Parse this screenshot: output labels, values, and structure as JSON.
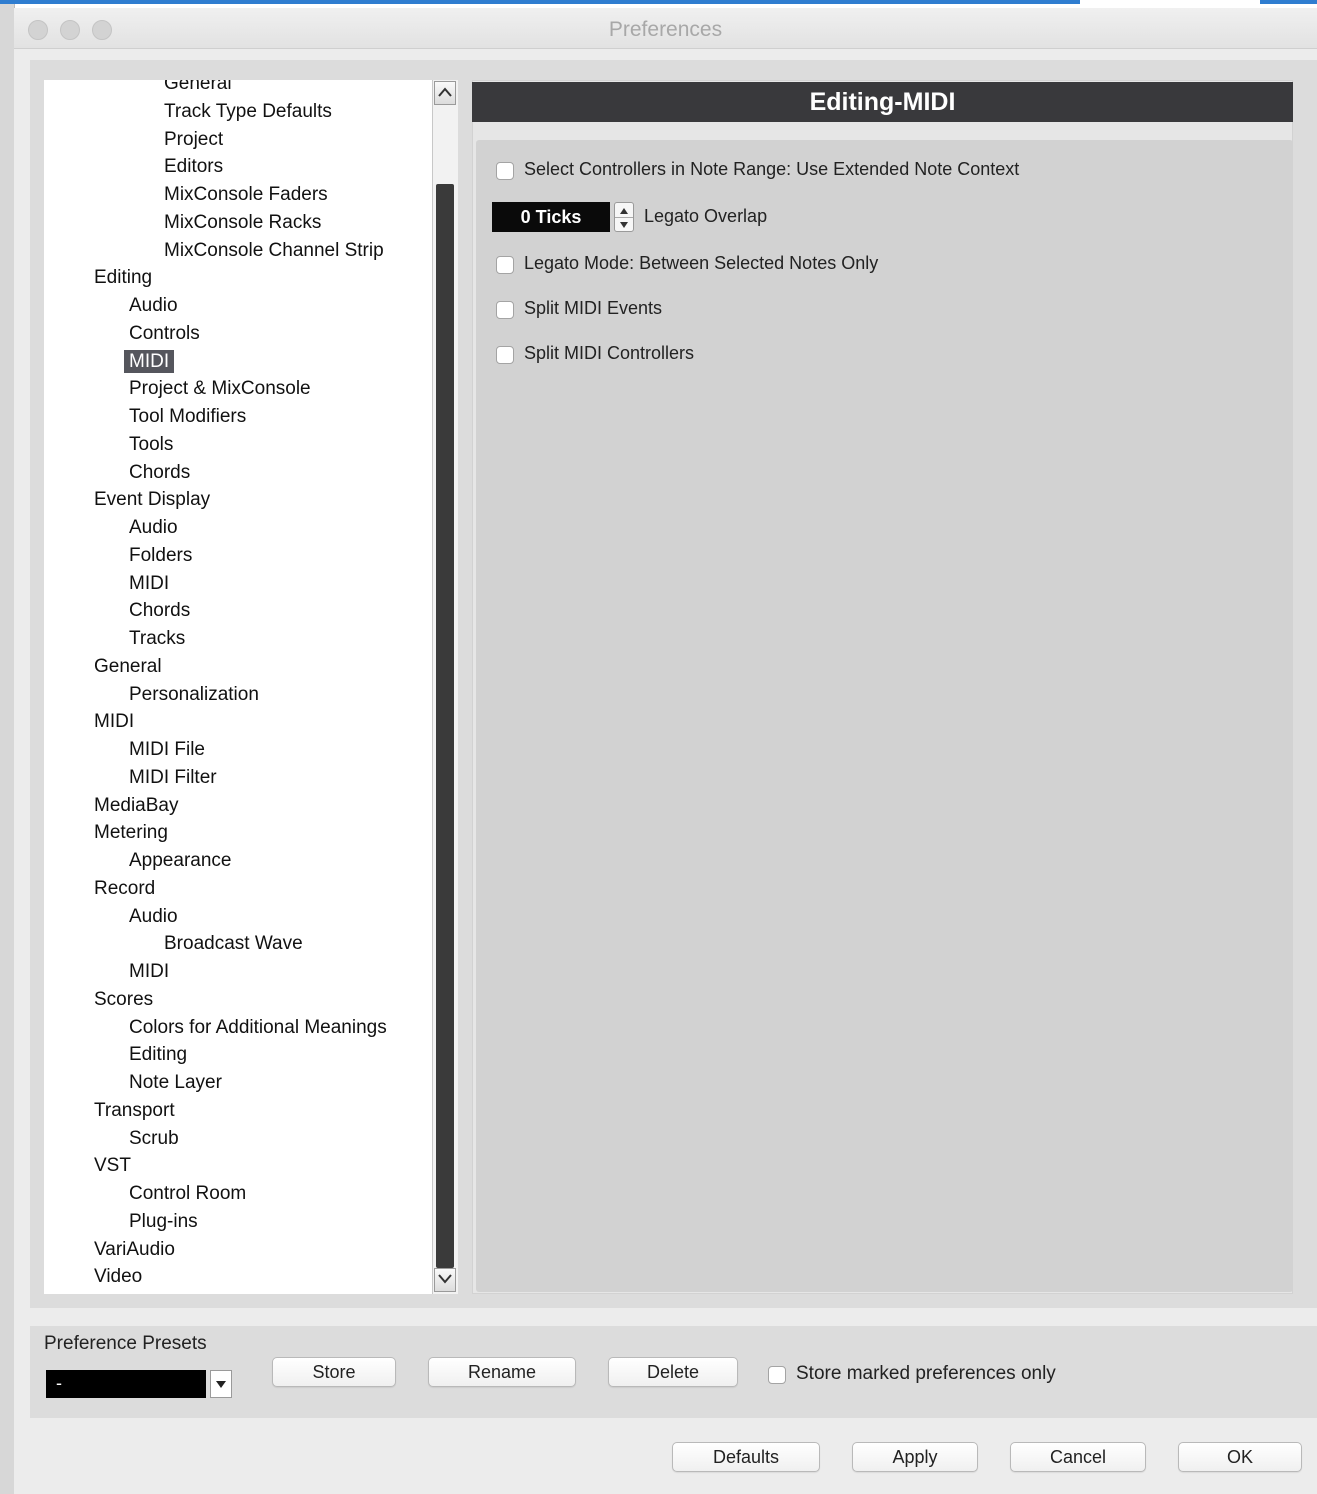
{
  "window": {
    "title": "Preferences"
  },
  "tree": {
    "items": [
      {
        "label": "General",
        "level": 2
      },
      {
        "label": "Track Type Defaults",
        "level": 2
      },
      {
        "label": "Project",
        "level": 2
      },
      {
        "label": "Editors",
        "level": 2
      },
      {
        "label": "MixConsole Faders",
        "level": 2
      },
      {
        "label": "MixConsole Racks",
        "level": 2
      },
      {
        "label": "MixConsole Channel Strip",
        "level": 2
      },
      {
        "label": "Editing",
        "level": 0
      },
      {
        "label": "Audio",
        "level": 1
      },
      {
        "label": "Controls",
        "level": 1
      },
      {
        "label": "MIDI",
        "level": 1,
        "selected": true
      },
      {
        "label": "Project & MixConsole",
        "level": 1
      },
      {
        "label": "Tool Modifiers",
        "level": 1
      },
      {
        "label": "Tools",
        "level": 1
      },
      {
        "label": "Chords",
        "level": 1
      },
      {
        "label": "Event Display",
        "level": 0
      },
      {
        "label": "Audio",
        "level": 1
      },
      {
        "label": "Folders",
        "level": 1
      },
      {
        "label": "MIDI",
        "level": 1
      },
      {
        "label": "Chords",
        "level": 1
      },
      {
        "label": "Tracks",
        "level": 1
      },
      {
        "label": "General",
        "level": 0
      },
      {
        "label": "Personalization",
        "level": 1
      },
      {
        "label": "MIDI",
        "level": 0
      },
      {
        "label": "MIDI File",
        "level": 1
      },
      {
        "label": "MIDI Filter",
        "level": 1
      },
      {
        "label": "MediaBay",
        "level": 0
      },
      {
        "label": "Metering",
        "level": 0
      },
      {
        "label": "Appearance",
        "level": 1
      },
      {
        "label": "Record",
        "level": 0
      },
      {
        "label": "Audio",
        "level": 1
      },
      {
        "label": "Broadcast Wave",
        "level": 2
      },
      {
        "label": "MIDI",
        "level": 1
      },
      {
        "label": "Scores",
        "level": 0
      },
      {
        "label": "Colors for Additional Meanings",
        "level": 1
      },
      {
        "label": "Editing",
        "level": 1
      },
      {
        "label": "Note Layer",
        "level": 1
      },
      {
        "label": "Transport",
        "level": 0
      },
      {
        "label": "Scrub",
        "level": 1
      },
      {
        "label": "VST",
        "level": 0
      },
      {
        "label": "Control Room",
        "level": 1
      },
      {
        "label": "Plug-ins",
        "level": 1
      },
      {
        "label": "VariAudio",
        "level": 0
      },
      {
        "label": "Video",
        "level": 0
      }
    ]
  },
  "section": {
    "title": "Editing-MIDI",
    "options": {
      "select_controllers": {
        "label": "Select Controllers in Note Range: Use Extended Note Context",
        "checked": false
      },
      "legato_overlap": {
        "value": "0 Ticks",
        "label": "Legato Overlap"
      },
      "legato_mode": {
        "label": "Legato Mode: Between Selected Notes Only",
        "checked": false
      },
      "split_events": {
        "label": "Split MIDI Events",
        "checked": false
      },
      "split_controllers": {
        "label": "Split MIDI Controllers",
        "checked": false
      }
    }
  },
  "presets": {
    "label": "Preference Presets",
    "selected": "-",
    "store_label": "Store",
    "rename_label": "Rename",
    "delete_label": "Delete",
    "store_marked_label": "Store marked preferences only",
    "store_marked_checked": false
  },
  "footer": {
    "defaults_label": "Defaults",
    "apply_label": "Apply",
    "cancel_label": "Cancel",
    "ok_label": "OK"
  }
}
